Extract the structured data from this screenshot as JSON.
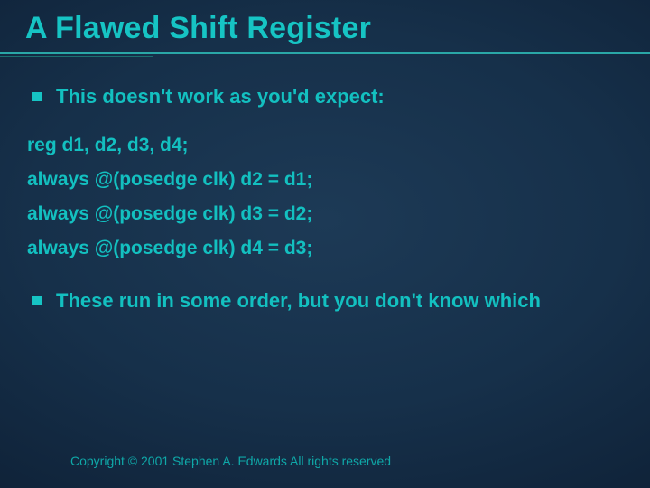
{
  "title": "A Flawed Shift Register",
  "bullets": {
    "b1": "This doesn't work as you'd expect:",
    "b2": "These run in some order, but you don't know which"
  },
  "code": {
    "decl": "reg d1, d2, d3, d4;",
    "l1": "always @(posedge clk) d2 = d1;",
    "l2": "always @(posedge clk) d3 = d2;",
    "l3": "always @(posedge clk) d4 = d3;"
  },
  "footer": "Copyright © 2001 Stephen A. Edwards  All rights reserved"
}
